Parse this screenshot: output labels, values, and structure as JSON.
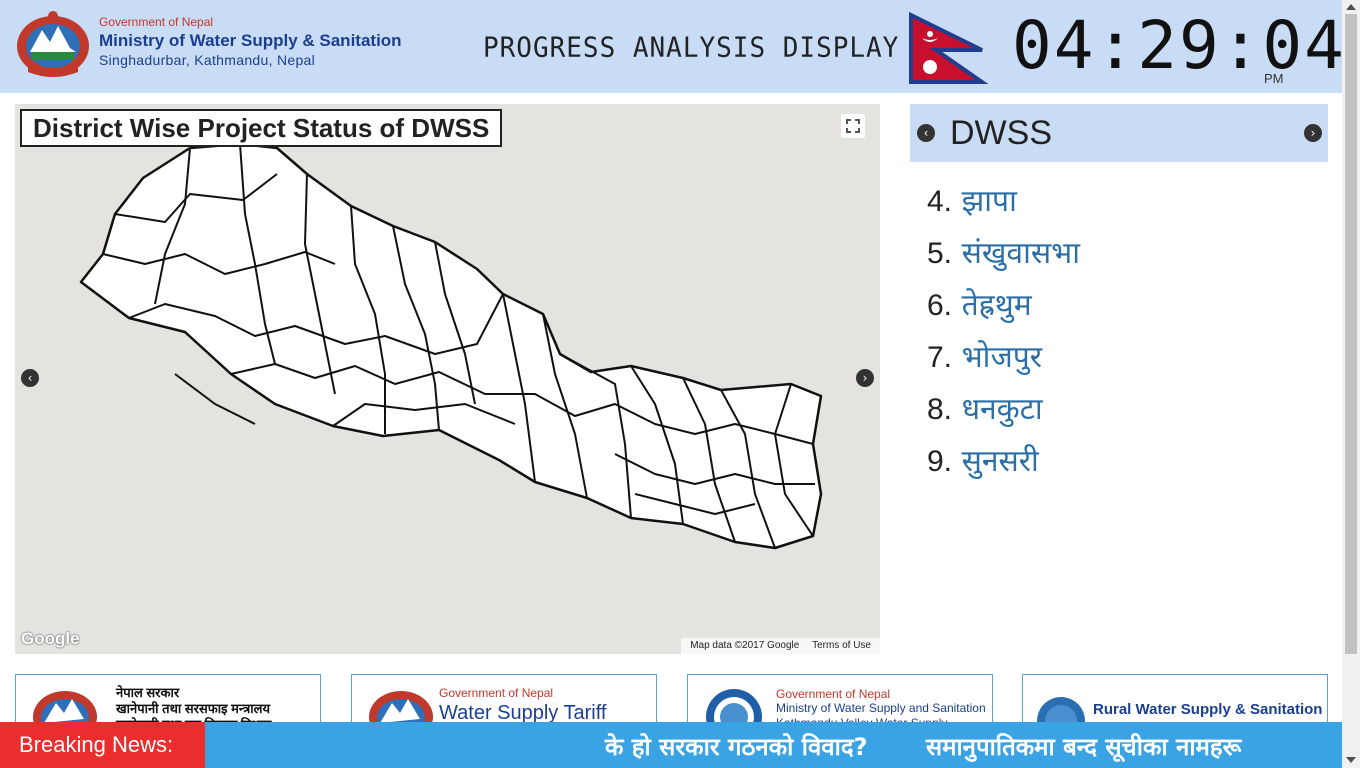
{
  "header": {
    "gov_line": "Government of Nepal",
    "ministry_line": "Ministry of Water Supply & Sanitation",
    "address_line": "Singhadurbar, Kathmandu, Nepal",
    "display_title": "PROGRESS ANALYSIS DISPLAY",
    "clock": "04:29:04",
    "ampm": "PM"
  },
  "map": {
    "title": "District Wise Project Status of DWSS",
    "google_logo": "Google",
    "attribution": [
      "Map data ©2017 Google",
      "Terms of Use"
    ]
  },
  "right_panel": {
    "title": "DWSS",
    "districts": [
      {
        "num": "4.",
        "name": "झापा"
      },
      {
        "num": "5.",
        "name": "संखुवासभा"
      },
      {
        "num": "6.",
        "name": "तेह्रथुम"
      },
      {
        "num": "7.",
        "name": "भोजपुर"
      },
      {
        "num": "8.",
        "name": "धनकुटा"
      },
      {
        "num": "9.",
        "name": "सुनसरी"
      }
    ]
  },
  "logos": [
    {
      "line1": "नेपाल सरकार",
      "line2": "खानेपानी तथा सरसफाइ मन्त्रालय",
      "line3": "खानेपानी तथा ढल निकास विभाग"
    },
    {
      "line1": "Government of Nepal",
      "line2": "Water Supply Tariff"
    },
    {
      "line1": "Government of Nepal",
      "line2": "Ministry of Water Supply and Sanitation",
      "line3": "Kathmandu Valley Water Supply"
    },
    {
      "line1": "Rural Water Supply & Sanitation"
    }
  ],
  "ticker": {
    "label": "Breaking News:",
    "items": [
      "के हो सरकार गठनको विवाद?",
      "समानुपातिकमा बन्द सूचीका नामहरू"
    ]
  },
  "colors": {
    "header_bg": "#c9dcf5",
    "ticker_bg": "#3aa3e3",
    "ticker_label_bg": "#ea2d2d",
    "ministry_blue": "#1a3f8f",
    "district_link": "#2c6fa6"
  }
}
